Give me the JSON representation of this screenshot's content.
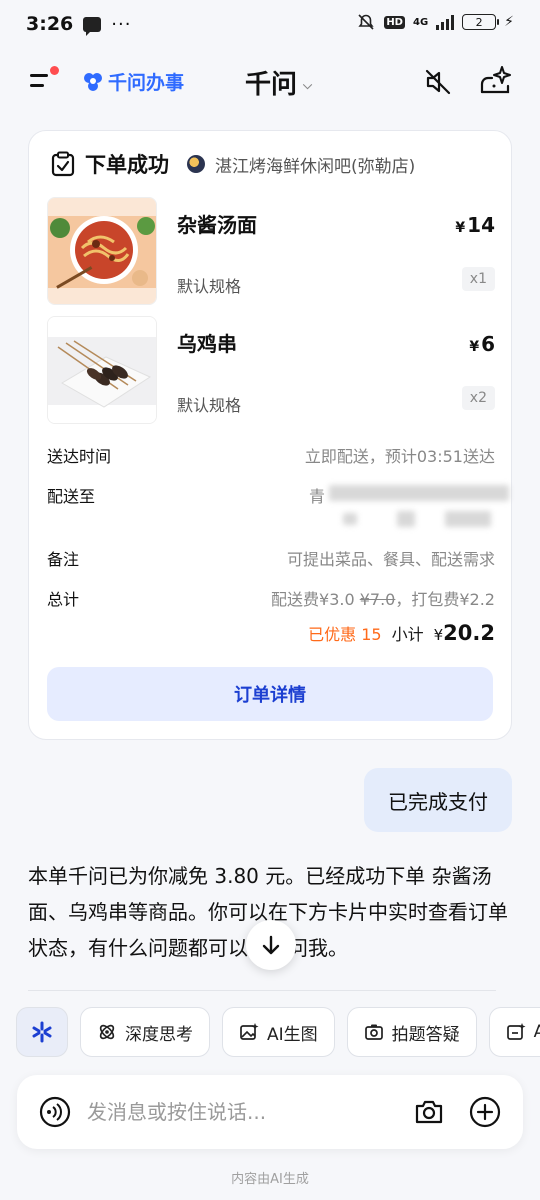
{
  "status_bar": {
    "time": "3:26",
    "dots": "···",
    "network": "4G",
    "hd": "HD",
    "battery": "2"
  },
  "header": {
    "brand": "千问办事",
    "title": "千问"
  },
  "order_card": {
    "title": "下单成功",
    "shop_name": "湛江烤海鲜休闲吧(弥勒店)",
    "items": [
      {
        "name": "杂酱汤面",
        "spec": "默认规格",
        "currency": "¥",
        "price": "14",
        "qty": "x1"
      },
      {
        "name": "乌鸡串",
        "spec": "默认规格",
        "currency": "¥",
        "price": "6",
        "qty": "x2"
      }
    ],
    "delivery_time_label": "送达时间",
    "delivery_time_value": "立即配送，预计03:51送达",
    "address_label": "配送至",
    "address_value_line1": "青",
    "note_label": "备注",
    "note_value": "可提出菜品、餐具、配送需求",
    "total_label": "总计",
    "fee_prefix": "配送费¥3.0 ",
    "fee_original": "¥7.0",
    "fee_suffix": "，打包费¥2.2",
    "discount": "已优惠 15",
    "subtotal_label": "小计",
    "subtotal_currency": "¥",
    "subtotal_value": "20.2",
    "detail_button": "订单详情"
  },
  "user_message": "已完成支付",
  "assistant_reply": "本单千问已为你减免 3.80 元。已经成功下单 杂酱汤面、乌鸡串等商品。你可以在下方卡片中实时查看订单状态，有什么问题都可以随时问我。",
  "chips": [
    {
      "label": "深度思考",
      "icon": "deep-think-icon"
    },
    {
      "label": "AI生图",
      "icon": "ai-image-icon"
    },
    {
      "label": "拍题答疑",
      "icon": "photo-question-icon"
    },
    {
      "label": "AI",
      "icon": "ai-edit-icon"
    }
  ],
  "input": {
    "placeholder": "发消息或按住说话..."
  },
  "footnote": "内容由AI生成",
  "colors": {
    "accent": "#2f6bff",
    "discount": "#ff6a1a",
    "button_bg": "#e6ecff",
    "bubble": "#e4ecfb"
  }
}
